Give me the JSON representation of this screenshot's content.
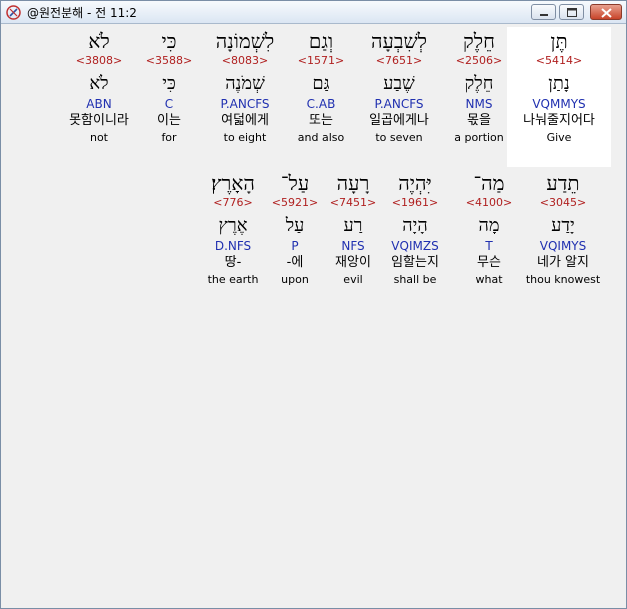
{
  "window": {
    "title": "@원전분해 - 전 11:2",
    "minimize_label": "",
    "maximize_label": "",
    "close_label": ""
  },
  "rows": [
    {
      "words": [
        {
          "hebrew": "תֶּן",
          "strong": "<5414>",
          "lemma": "נָתַן",
          "parse": "VQMMYS",
          "korean": "나눠줄지어다",
          "english": "Give",
          "highlighted": true
        },
        {
          "hebrew": "חֵלֶק",
          "strong": "<2506>",
          "lemma": "חֵלֶק",
          "parse": "NMS",
          "korean": "몫을",
          "english": "a portion"
        },
        {
          "hebrew": "לְשִׁבְעָה",
          "strong": "<7651>",
          "lemma": "שֶׁבַע",
          "parse": "P.ANCFS",
          "korean": "일곱에게나",
          "english": "to seven"
        },
        {
          "hebrew": "וְגַם",
          "strong": "<1571>",
          "lemma": "גַּם",
          "parse": "C.AB",
          "korean": "또는",
          "english": "and also"
        },
        {
          "hebrew": "לִשְׁמוֹנָה",
          "strong": "<8083>",
          "lemma": "שְׁמֹנֶה",
          "parse": "P.ANCFS",
          "korean": "여덟에게",
          "english": "to eight"
        },
        {
          "hebrew": "כִּי",
          "strong": "<3588>",
          "lemma": "כִּי",
          "parse": "C",
          "korean": "이는",
          "english": "for"
        },
        {
          "hebrew": "לֹא",
          "strong": "<3808>",
          "lemma": "לֹא",
          "parse": "ABN",
          "korean": "못함이니라",
          "english": "not"
        }
      ]
    },
    {
      "words": [
        {
          "hebrew": "תֵדַע",
          "strong": "<3045>",
          "lemma": "יָדַע",
          "parse": "VQIMYS",
          "korean": "네가 알지",
          "english": "thou knowest"
        },
        {
          "hebrew": "מַה־",
          "strong": "<4100>",
          "lemma": "מָה",
          "parse": "T",
          "korean": "무슨",
          "english": "what"
        },
        {
          "hebrew": "יִּהְיֶה",
          "strong": "<1961>",
          "lemma": "הָיָה",
          "parse": "VQIMZS",
          "korean": "임할는지",
          "english": "shall be"
        },
        {
          "hebrew": "רָעָה",
          "strong": "<7451>",
          "lemma": "רַע",
          "parse": "NFS",
          "korean": "재앙이",
          "english": "evil"
        },
        {
          "hebrew": "עַל־",
          "strong": "<5921>",
          "lemma": "עַל",
          "parse": "P",
          "korean": "-에",
          "english": "upon"
        },
        {
          "hebrew": "הָאָרֶץ׃",
          "strong": "<776>",
          "lemma": "אֶרֶץ",
          "parse": "D.NFS",
          "korean": "땅-",
          "english": "the earth"
        }
      ]
    }
  ]
}
